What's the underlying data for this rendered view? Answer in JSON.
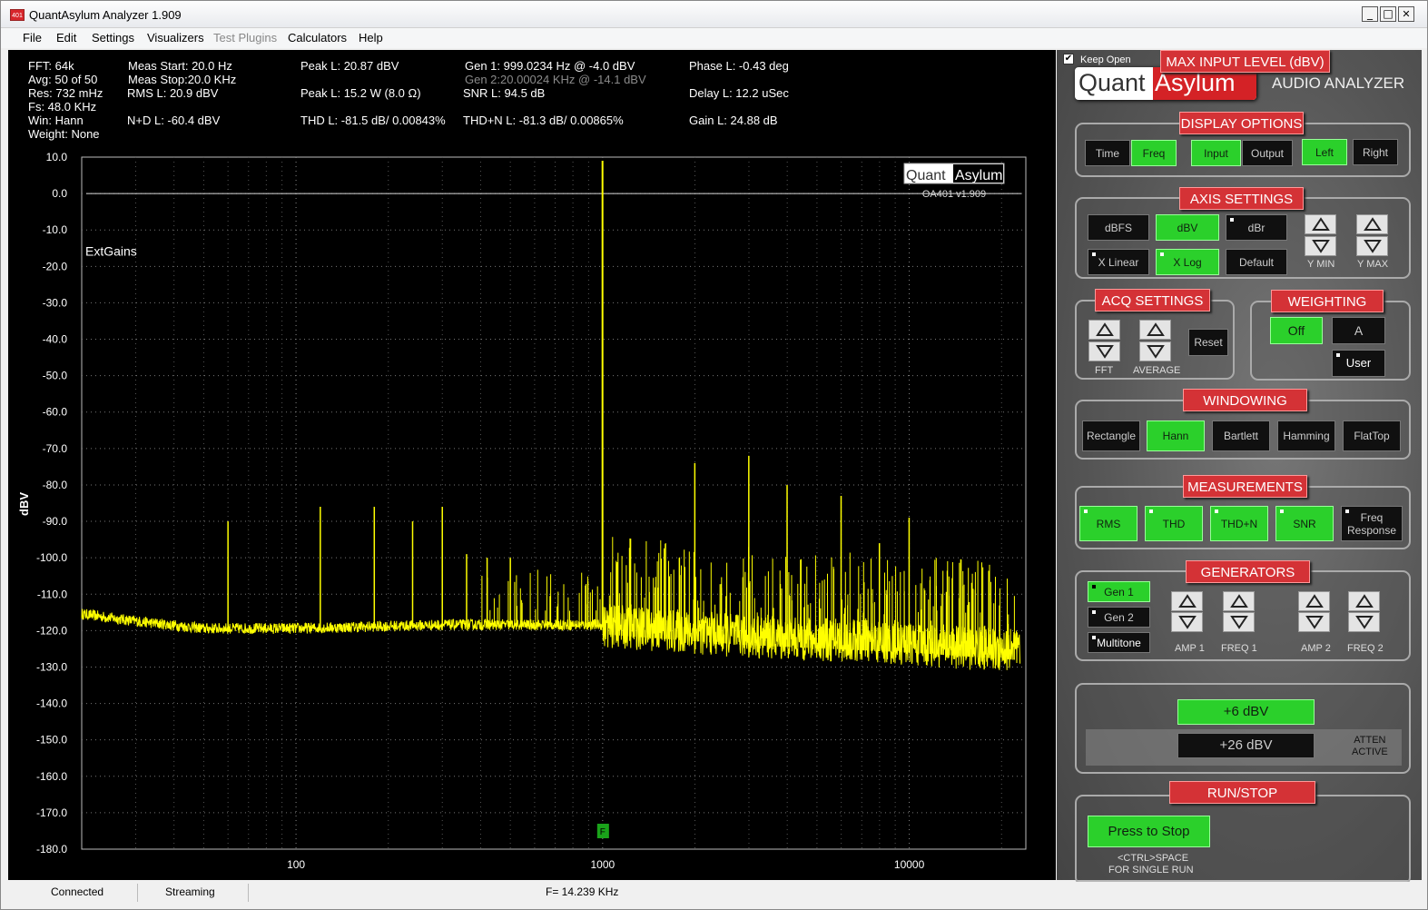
{
  "window": {
    "title": "QuantAsylum Analyzer 1.909",
    "icon_text": "401",
    "min": "_",
    "max": "□",
    "close": "✕"
  },
  "menu": [
    "File",
    "Edit",
    "Settings",
    "Visualizers",
    "Test Plugins",
    "Calculators",
    "Help"
  ],
  "stats": {
    "fft": "FFT: 64k",
    "avg": "Avg: 50 of 50",
    "res": "Res: 732 mHz",
    "fs": "Fs: 48.0 KHz",
    "win": "Win: Hann",
    "weight": "Weight: None",
    "meas_start": "Meas Start: 20.0 Hz",
    "meas_stop": "Meas Stop:20.0 KHz",
    "rms": "RMS L: 20.9 dBV",
    "nd": "N+D L: -60.4 dBV",
    "peak_dbv": "Peak L: 20.87 dBV",
    "peak_w": "Peak L: 15.2 W (8.0 Ω)",
    "thd": "THD L: -81.5 dB/ 0.00843%",
    "gen1": "Gen 1: 999.0234 Hz @ -4.0  dBV",
    "gen2": "Gen 2:20.00024 KHz @ -14.1  dBV",
    "snr": "SNR L: 94.5 dB",
    "thdn": "THD+N L: -81.3 dB/ 0.00865%",
    "phase": "Phase L: -0.43 deg",
    "delay": "Delay L: 12.2 uSec",
    "gain": "Gain L: 24.88 dB"
  },
  "chart_data": {
    "type": "line",
    "ylabel": "dBV",
    "xlabel": "",
    "xscale": "log",
    "xlim": [
      20,
      24000
    ],
    "ylim": [
      -180,
      10
    ],
    "yticks": [
      "10.0",
      "0.0",
      "-10.0",
      "-20.0",
      "-30.0",
      "-40.0",
      "-50.0",
      "-60.0",
      "-70.0",
      "-80.0",
      "-90.0",
      "-100.0",
      "-110.0",
      "-120.0",
      "-130.0",
      "-140.0",
      "-150.0",
      "-160.0",
      "-170.0",
      "-180.0"
    ],
    "xticks": [
      "100",
      "1000",
      "10000"
    ],
    "grid": true,
    "reference_line_dbv": 0,
    "series_color": "#ffff00",
    "noise_floor": [
      [
        20,
        -116
      ],
      [
        30,
        -118
      ],
      [
        50,
        -120
      ],
      [
        100,
        -120
      ],
      [
        300,
        -119
      ],
      [
        999,
        -119
      ],
      [
        1000,
        -121
      ],
      [
        3000,
        -124
      ],
      [
        10000,
        -126
      ],
      [
        22000,
        -128
      ]
    ],
    "peaks": [
      [
        60,
        -90
      ],
      [
        120,
        -86
      ],
      [
        180,
        -86
      ],
      [
        240,
        -90
      ],
      [
        300,
        -86
      ],
      [
        360,
        -99
      ],
      [
        420,
        -100
      ],
      [
        500,
        -100
      ],
      [
        999,
        9
      ],
      [
        1998,
        -74
      ],
      [
        2997,
        -72
      ],
      [
        3996,
        -80
      ],
      [
        5994,
        -83
      ],
      [
        7992,
        -96
      ],
      [
        9990,
        -89
      ]
    ],
    "annotation": "ExtGains",
    "watermark": "QuantAsylum",
    "watermark_quant": "Quant",
    "watermark_asylum": "Asylum",
    "watermark_version": "OA401 v1.909",
    "marker_label": "F",
    "marker_freq": 1000
  },
  "panel": {
    "keep_open": "Keep Open",
    "logo_quant": "Quant",
    "logo_asylum": "Asylum",
    "logo_sub": "AUDIO ANALYZER",
    "display_options": {
      "header": "DISPLAY OPTIONS",
      "time": "Time",
      "freq": "Freq",
      "input": "Input",
      "output": "Output",
      "left": "Left",
      "right": "Right"
    },
    "axis_settings": {
      "header": "AXIS SETTINGS",
      "dbfs": "dBFS",
      "dbv": "dBV",
      "dbr": "dBr",
      "xlinear": "X Linear",
      "xlog": "X Log",
      "default": "Default",
      "ymin": "Y MIN",
      "ymax": "Y MAX"
    },
    "acq": {
      "header": "ACQ SETTINGS",
      "fft": "FFT",
      "average": "AVERAGE",
      "reset": "Reset"
    },
    "weighting": {
      "header": "WEIGHTING",
      "off": "Off",
      "a": "A",
      "user": "User"
    },
    "windowing": {
      "header": "WINDOWING",
      "items": [
        "Rectangle",
        "Hann",
        "Bartlett",
        "Hamming",
        "FlatTop"
      ]
    },
    "measurements": {
      "header": "MEASUREMENTS",
      "rms": "RMS",
      "thd": "THD",
      "thdn": "THD+N",
      "snr": "SNR",
      "freqresp": "Freq Response"
    },
    "generators": {
      "header": "GENERATORS",
      "gen1": "Gen 1",
      "gen2": "Gen 2",
      "multitone": "Multitone",
      "amp1": "AMP 1",
      "freq1": "FREQ 1",
      "amp2": "AMP 2",
      "freq2": "FREQ 2"
    },
    "max_input": {
      "header": "MAX INPUT LEVEL (dBV)",
      "six": "+6 dBV",
      "twentysix": "+26 dBV",
      "atten": "ATTEN\nACTIVE"
    },
    "runstop": {
      "header": "RUN/STOP",
      "button": "Press to Stop",
      "hint1": "<CTRL>SPACE",
      "hint2": "FOR SINGLE RUN"
    }
  },
  "status": {
    "connected": "Connected",
    "streaming": "Streaming",
    "freq": "F= 14.239 KHz"
  }
}
